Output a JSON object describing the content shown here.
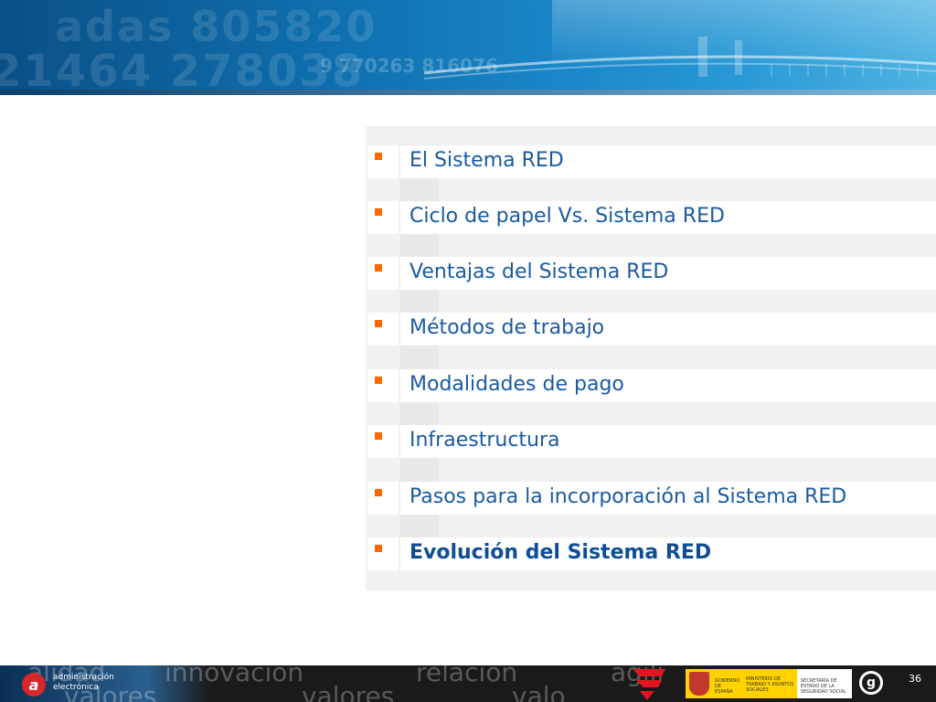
{
  "header": {
    "bg_numbers_1": "adas 805820",
    "bg_numbers_2": "21464 278038",
    "bg_numbers_3": "9 770263 816076"
  },
  "agenda": {
    "bullet_color": "#ff6600",
    "text_color": "#1a5aa0",
    "items": [
      {
        "label": "El Sistema RED",
        "bold": false
      },
      {
        "label": "Ciclo de papel Vs. Sistema RED",
        "bold": false
      },
      {
        "label": "Ventajas del Sistema RED",
        "bold": false
      },
      {
        "label": "Métodos de trabajo",
        "bold": false
      },
      {
        "label": "Modalidades de pago",
        "bold": false
      },
      {
        "label": "Infraestructura",
        "bold": false
      },
      {
        "label": "Pasos para la incorporación al Sistema RED",
        "bold": false
      },
      {
        "label": "Evolución del Sistema RED",
        "bold": true
      }
    ]
  },
  "footer": {
    "words": [
      "alidad",
      "innovacion",
      "relacion",
      "agili"
    ],
    "words_lower": [
      "valores",
      "valores",
      "valo"
    ],
    "ae_logo_line1": "administración",
    "ae_logo_line2": "electrónica",
    "gov_line1": "GOBIERNO DE ESPAÑA",
    "gov_line2": "MINISTERIO DE TRABAJO Y ASUNTOS SOCIALES",
    "gov_line3": "SECRETARÍA DE ESTADO DE LA SEGURIDAD SOCIAL",
    "page_number": "36"
  }
}
